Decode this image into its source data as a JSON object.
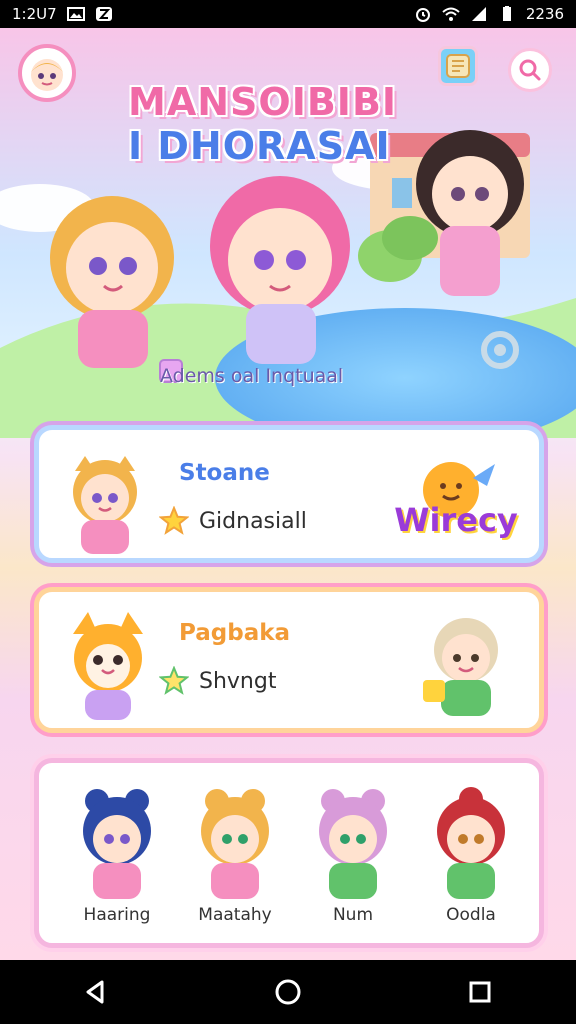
{
  "status": {
    "time": "1:2U7",
    "clock": "2236"
  },
  "game": {
    "title_line1": "MANSOIBIBI",
    "title_line2": "I DHORASAI",
    "subtitle": "Adems oal Inqtuaal"
  },
  "cards": {
    "card1": {
      "title": "Stoane",
      "label": "Gidnasiall",
      "badge": "Wirecy"
    },
    "card2": {
      "title": "Pagbaka",
      "label": "Shvngt"
    }
  },
  "characters": [
    {
      "name": "Haaring"
    },
    {
      "name": "Maatahy"
    },
    {
      "name": "Num"
    },
    {
      "name": "Oodla"
    }
  ],
  "colors": {
    "accent_pink": "#f58fbf",
    "accent_blue": "#4a7ee8",
    "accent_orange": "#f29b36"
  }
}
